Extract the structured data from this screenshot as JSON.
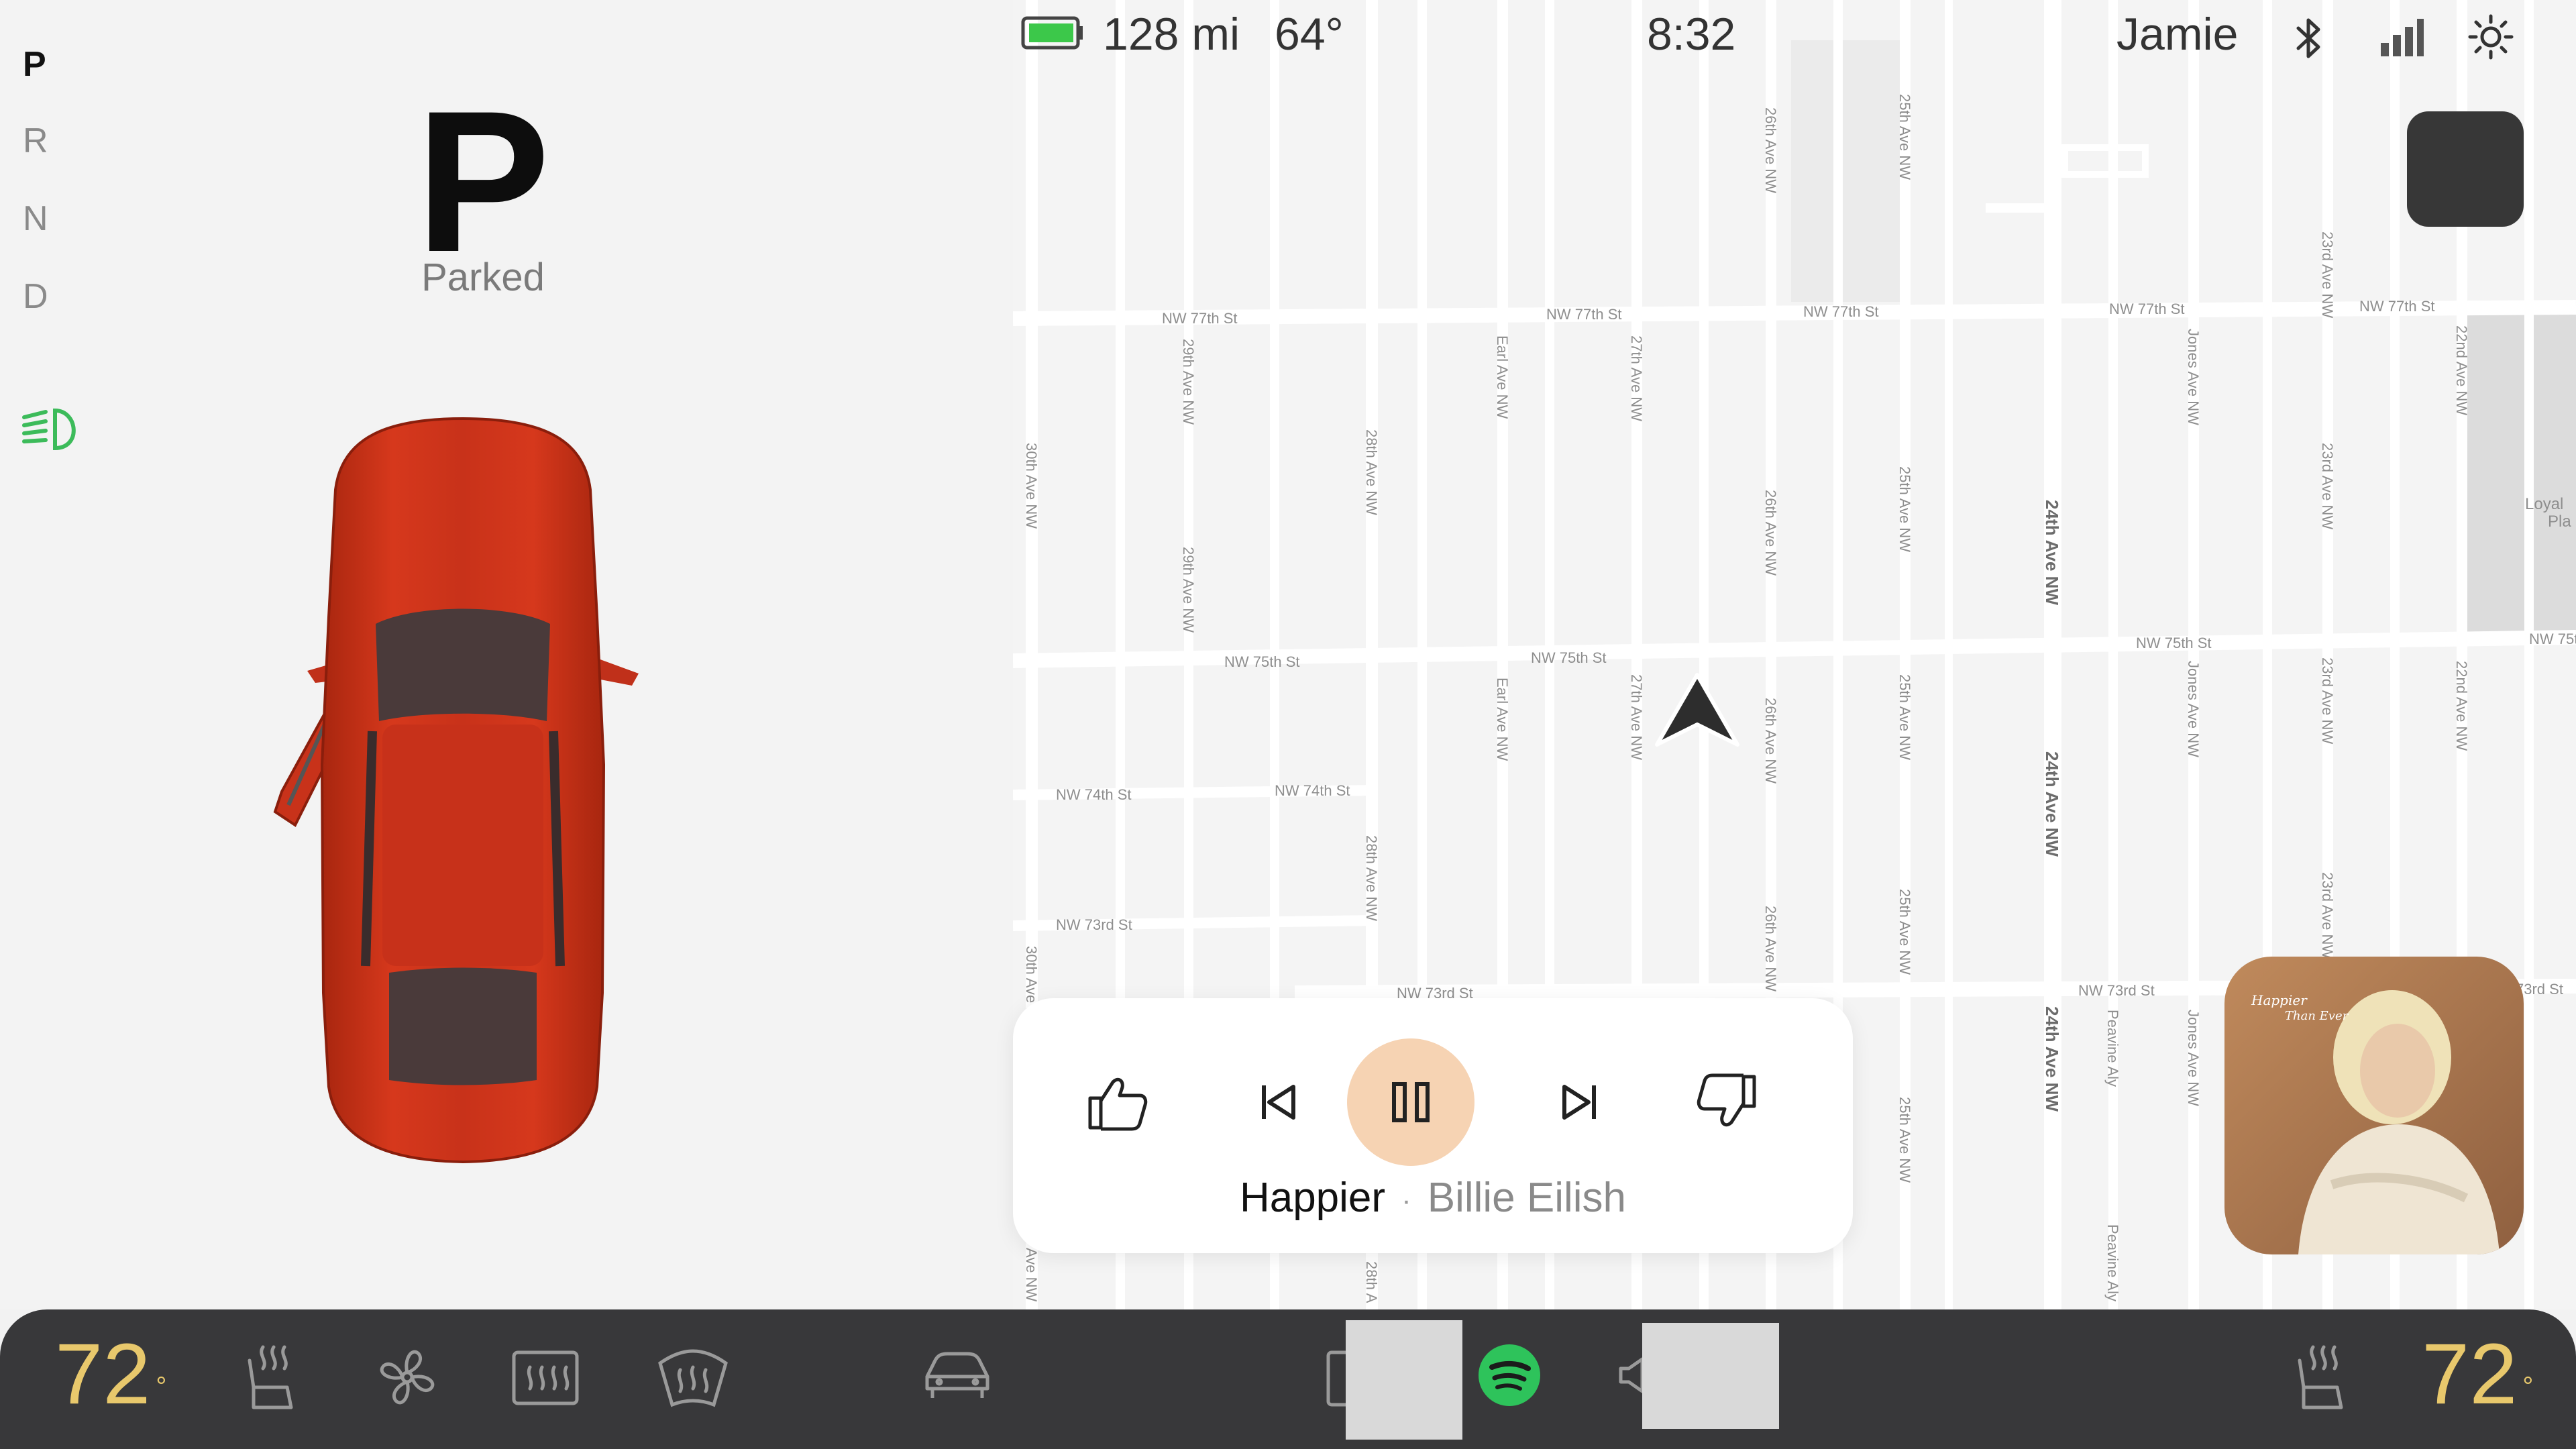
{
  "gear_selector": {
    "gears": [
      "P",
      "R",
      "N",
      "D"
    ],
    "active": "P",
    "big_gear": "P",
    "status": "Parked"
  },
  "status_bar": {
    "range": "128 mi",
    "outside_temp": "64°",
    "time": "8:32",
    "driver": "Jamie",
    "battery_color": "#3cc84a"
  },
  "map": {
    "streets_h": [
      "NW 77th St",
      "NW 77th St",
      "NW 77th St",
      "NW 77th St",
      "NW 77th St",
      "NW 75th St",
      "NW 75th St",
      "NW 75th St",
      "NW 75th",
      "NW 74th St",
      "NW 74th St",
      "NW 73rd St",
      "NW 73rd St",
      "NW 73rd St",
      "73rd St"
    ],
    "streets_v": [
      "30th Ave NW",
      "29th Ave NW",
      "29th Ave NW",
      "28th Ave NW",
      "28th Ave NW",
      "Earl Ave NW",
      "Earl Ave NW",
      "27th Ave NW",
      "27th Ave NW",
      "26th Ave NW",
      "26th Ave NW",
      "26th Ave NW",
      "26th Ave NW",
      "25th Ave NW",
      "25th Ave NW",
      "25th Ave NW",
      "25th Ave NW",
      "25th Ave NW",
      "Jones Ave NW",
      "Jones Ave NW",
      "Jones Ave NW",
      "23rd Ave NW",
      "23rd Ave NW",
      "23rd Ave NW",
      "23rd Ave NW",
      "22nd Ave NW",
      "22nd Ave NW",
      "Peavine Aly",
      "Peavine Aly",
      "30th Ave NW",
      "Ave NW",
      "28th A"
    ],
    "streets_bold": [
      "24th Ave NW",
      "24th Ave NW",
      "24th Ave NW"
    ],
    "poi": [
      "Loyal",
      "Pla"
    ]
  },
  "media": {
    "title": "Happier",
    "separator": "·",
    "artist": "Billie Eilish",
    "album_cover_text": [
      "Happier",
      "Than Ever"
    ]
  },
  "climate": {
    "driver_temp": "72",
    "passenger_temp": "72",
    "degree": "°",
    "accent_color": "#e8c86c"
  },
  "icons": {
    "headlight": "headlight-icon",
    "bluetooth": "bluetooth-icon",
    "signal": "signal-icon",
    "brightness": "brightness-icon",
    "thumbs_up": "thumbs-up-icon",
    "prev": "previous-track-icon",
    "pause": "pause-icon",
    "next": "next-track-icon",
    "thumbs_down": "thumbs-down-icon",
    "seat_heat_left": "seat-heater-left-icon",
    "fan": "fan-icon",
    "rear_defrost": "rear-defrost-icon",
    "front_defrost": "front-defrost-icon",
    "car": "car-icon",
    "spotify": "spotify-icon",
    "volume": "volume-icon",
    "seat_heat_right": "seat-heater-right-icon"
  }
}
